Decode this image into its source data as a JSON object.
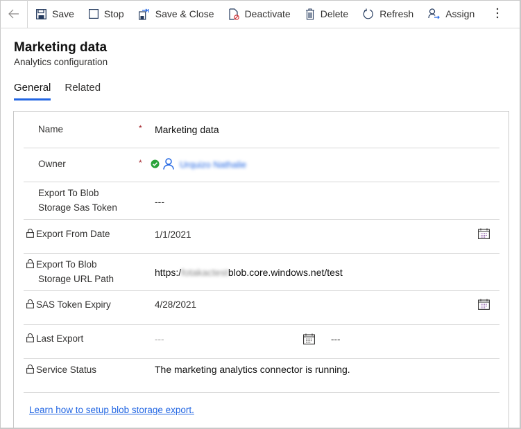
{
  "toolbar": {
    "back_icon": "arrow-left-icon",
    "commands": [
      {
        "label": "Save",
        "icon": "save-icon"
      },
      {
        "label": "Stop",
        "icon": "stop-icon"
      },
      {
        "label": "Save & Close",
        "icon": "save-close-icon"
      },
      {
        "label": "Deactivate",
        "icon": "deactivate-icon"
      },
      {
        "label": "Delete",
        "icon": "delete-icon"
      },
      {
        "label": "Refresh",
        "icon": "refresh-icon"
      },
      {
        "label": "Assign",
        "icon": "assign-icon"
      }
    ],
    "more_icon": "more-vertical-icon"
  },
  "header": {
    "title": "Marketing data",
    "subtitle": "Analytics configuration"
  },
  "tabs": [
    {
      "label": "General",
      "active": true
    },
    {
      "label": "Related",
      "active": false
    }
  ],
  "fields": {
    "name": {
      "label": "Name",
      "required": "*",
      "value": "Marketing data"
    },
    "owner": {
      "label": "Owner",
      "required": "*",
      "value": "Urquizo Nathalie",
      "status": "resolved"
    },
    "sas_token": {
      "label_line1": "Export To Blob",
      "label_line2": "Storage Sas Token",
      "value": "---"
    },
    "export_from_date": {
      "label": "Export From Date",
      "value": "1/1/2021"
    },
    "url_path": {
      "label_line1": "Export To Blob",
      "label_line2": "Storage URL Path",
      "value_prefix": "https:/",
      "value_hidden": "fotakactest",
      "value_suffix": "blob.core.windows.net/test"
    },
    "sas_expiry": {
      "label": "SAS Token Expiry",
      "value": "4/28/2021"
    },
    "last_export": {
      "label": "Last Export",
      "date_value": "---",
      "time_value": "---"
    },
    "service_status": {
      "label": "Service Status",
      "value": "The marketing analytics connector is running."
    }
  },
  "footer_link": "Learn how to setup blob storage export.",
  "colors": {
    "accent": "#2266e3",
    "required": "#a4262c",
    "success": "#2aa33a"
  }
}
